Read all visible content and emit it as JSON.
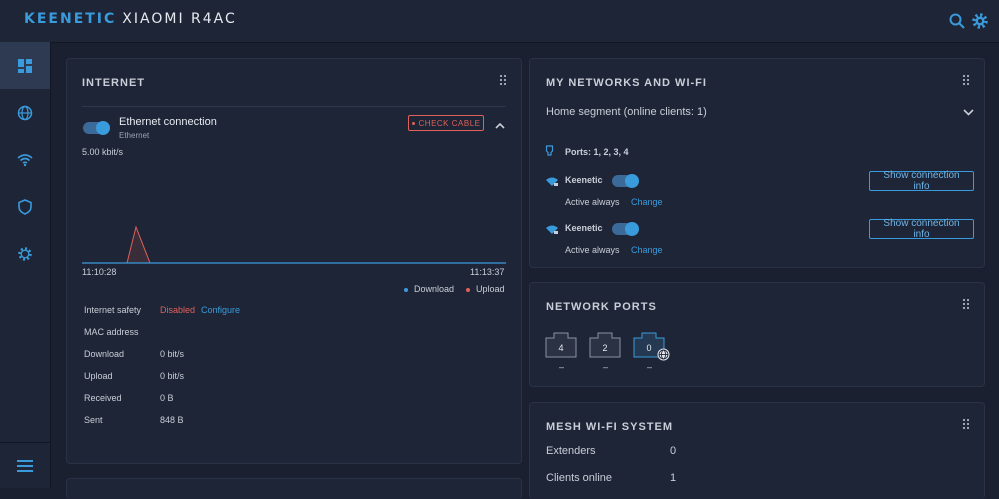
{
  "brand": {
    "name": "KEENETIC",
    "model": "XIAOMI R4AC"
  },
  "colors": {
    "accent": "#3a9bdc",
    "error": "#e0605a",
    "upload": "#e0605a",
    "download": "#3a9bdc"
  },
  "topbar": {
    "icons": [
      "search-icon",
      "gear-icon"
    ]
  },
  "sidebar": {
    "items": [
      "dashboard-icon",
      "globe-icon",
      "wifi-icon",
      "shield-icon",
      "gear-icon",
      "menu-icon"
    ]
  },
  "internet": {
    "title": "INTERNET",
    "connection_name": "Ethernet connection",
    "connection_type": "Ethernet",
    "status_badge": "CHECK CABLE",
    "speed": "5.00 kbit/s",
    "time_start": "11:10:28",
    "time_end": "11:13:37",
    "legend": {
      "download": "Download",
      "upload": "Upload"
    },
    "rows": [
      {
        "label": "Internet safety",
        "value": "Disabled",
        "link": "Configure"
      },
      {
        "label": "MAC address",
        "value": ""
      },
      {
        "label": "Download",
        "value": "0 bit/s"
      },
      {
        "label": "Upload",
        "value": "0 bit/s"
      },
      {
        "label": "Received",
        "value": "0 B"
      },
      {
        "label": "Sent",
        "value": "848 B"
      }
    ]
  },
  "networks": {
    "title": "MY NETWORKS AND WI-FI",
    "segment": "Home segment (online clients: 1)",
    "ports_label": "Ports: 1, 2, 3, 4",
    "wifi": [
      {
        "name": "Keenetic",
        "schedule": "Active always",
        "change": "Change",
        "button": "Show connection info"
      },
      {
        "name": "Keenetic",
        "schedule": "Active always",
        "change": "Change",
        "button": "Show connection info"
      }
    ]
  },
  "ports": {
    "title": "NETWORK PORTS",
    "items": [
      {
        "number": "4",
        "status": "–"
      },
      {
        "number": "2",
        "status": "–"
      },
      {
        "number": "0",
        "status": "–"
      }
    ]
  },
  "mesh": {
    "title": "MESH WI-FI SYSTEM",
    "rows": [
      {
        "label": "Extenders",
        "value": "0"
      },
      {
        "label": "Clients online",
        "value": "1"
      }
    ]
  }
}
